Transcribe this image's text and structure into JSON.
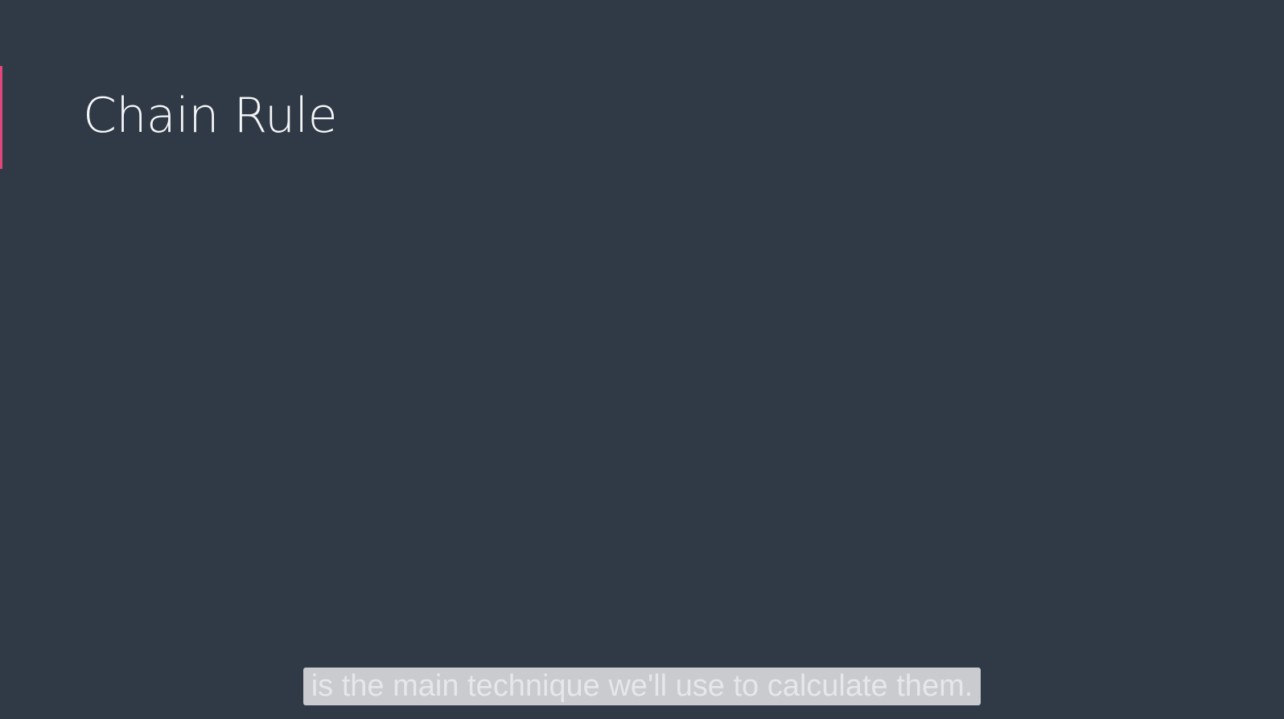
{
  "slide": {
    "title": "Chain Rule",
    "accent_color": "#e0497a",
    "background_color": "#303a47"
  },
  "caption": {
    "text": "is the main technique we'll use to calculate them."
  }
}
